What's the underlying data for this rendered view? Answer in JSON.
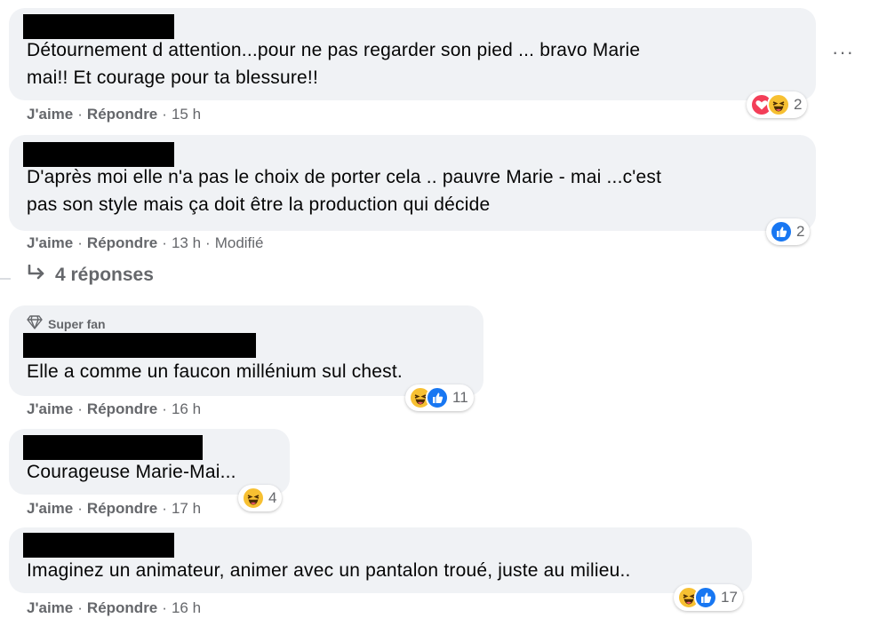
{
  "more_label": "···",
  "comments": [
    {
      "text_lines": [
        "Détournement d attention...pour ne pas regarder son pied ... bravo Marie",
        "mai!! Et courage pour ta blessure!!"
      ],
      "like": "J'aime",
      "reply": "Répondre",
      "time": "15 h",
      "edited": "",
      "reactions": [
        "love",
        "haha"
      ],
      "reaction_count": "2"
    },
    {
      "text_lines": [
        "D'après moi elle n'a pas le choix de porter cela .. pauvre Marie - mai ...c'est",
        "pas son style mais ça doit être la production qui décide"
      ],
      "like": "J'aime",
      "reply": "Répondre",
      "time": "13 h",
      "edited": "Modifié",
      "reactions": [
        "like"
      ],
      "reaction_count": "2"
    }
  ],
  "replies_link": "4 réponses",
  "replies": [
    {
      "badge": "Super fan",
      "text_lines": [
        "Elle a comme un faucon millénium sul chest."
      ],
      "like": "J'aime",
      "reply": "Répondre",
      "time": "16 h",
      "reactions": [
        "haha",
        "like"
      ],
      "reaction_count": "11"
    },
    {
      "text_lines": [
        "Courageuse Marie-Mai..."
      ],
      "like": "J'aime",
      "reply": "Répondre",
      "time": "17 h",
      "reactions": [
        "haha"
      ],
      "reaction_count": "4"
    },
    {
      "text_lines": [
        "Imaginez un animateur, animer avec un pantalon troué, juste au milieu.."
      ],
      "like": "J'aime",
      "reply": "Répondre",
      "time": "16 h",
      "reactions": [
        "haha",
        "like"
      ],
      "reaction_count": "17"
    }
  ],
  "colors": {
    "bubble": "#f0f2f5",
    "meta": "#65676b",
    "like_blue": "#1877f2",
    "love_red": "#f33e58",
    "haha_yellow": "#f7c032"
  }
}
